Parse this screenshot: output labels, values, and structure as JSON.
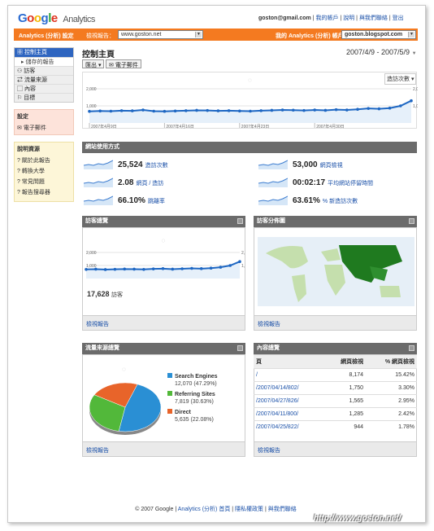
{
  "header": {
    "logo_google": "Google",
    "logo_analytics": "Analytics",
    "email": "goston@gmail.com",
    "links": [
      "我的帳戶",
      "說明",
      "與我們聯絡",
      "登出"
    ]
  },
  "toolbar": {
    "settings_label": "Analytics (分析) 設定",
    "view_report_label": "檢視報告：",
    "site_select": "www.goston.net",
    "account_label": "我的 Analytics (分析) 帳戶：",
    "account_select": "goston.blogspot.com"
  },
  "sidebar": {
    "nav": [
      {
        "label": "控制主頁",
        "active": true
      },
      {
        "label": "儲存的報告",
        "sub": true
      },
      {
        "label": "訪客"
      },
      {
        "label": "流量來源"
      },
      {
        "label": "內容"
      },
      {
        "label": "目標"
      }
    ],
    "settings_title": "設定",
    "settings_item": "電子郵件",
    "help_title": "說明資源",
    "help_items": [
      "關於此報告",
      "轉換大學",
      "常見問題",
      "報告搜尋器"
    ]
  },
  "page": {
    "title": "控制主頁",
    "date_range": "2007/4/9 - 2007/5/9",
    "export_btn": "匯出",
    "email_btn": "電子郵件",
    "visits_dropdown": "造訪次數"
  },
  "main_chart": {
    "y_labels": [
      "2,000",
      "1,000",
      "2,000",
      "1,000"
    ],
    "x_labels": [
      "2007年4月9日",
      "2007年4月16日",
      "2007年4月23日",
      "2007年4月30日"
    ],
    "values": [
      680,
      700,
      690,
      720,
      710,
      760,
      690,
      680,
      700,
      720,
      740,
      730,
      710,
      720,
      700,
      690,
      720,
      740,
      760,
      750,
      730,
      760,
      740,
      780,
      760,
      800,
      850,
      830,
      870,
      1000,
      1300
    ],
    "ylim": [
      0,
      2000
    ]
  },
  "site_usage": {
    "title": "網站使用方式",
    "metrics": [
      {
        "value": "25,524",
        "label": "造訪次數"
      },
      {
        "value": "53,000",
        "label": "網頁檢視"
      },
      {
        "value": "2.08",
        "label": "網頁 / 造訪"
      },
      {
        "value": "00:02:17",
        "label": "平均網站停留時間"
      },
      {
        "value": "66.10%",
        "label": "跳離率"
      },
      {
        "value": "63.61%",
        "label": "% 新造訪次數"
      }
    ]
  },
  "visitors_overview": {
    "title": "訪客總覽",
    "y_labels": [
      "2,000",
      "1,000",
      "2,000",
      "1,000"
    ],
    "values": [
      700,
      720,
      690,
      710,
      730,
      720,
      700,
      740,
      760,
      720,
      750,
      780,
      760,
      800,
      870,
      1000,
      1300
    ],
    "total": "17,628",
    "total_label": "訪客",
    "footer_link": "檢視報告"
  },
  "map_overlay": {
    "title": "訪客分佈圖",
    "footer_link": "檢視報告"
  },
  "traffic_sources": {
    "title": "流量來源總覽",
    "footer_link": "檢視報告",
    "colors": {
      "search": "#2a8fd4",
      "referring": "#52b83a",
      "direct": "#e8642a"
    },
    "items": [
      {
        "label": "Search Engines",
        "detail": "12,070 (47.29%)",
        "pct": 47.29
      },
      {
        "label": "Referring Sites",
        "detail": "7,819 (30.63%)",
        "pct": 30.63
      },
      {
        "label": "Direct",
        "detail": "5,635 (22.08%)",
        "pct": 22.08
      }
    ]
  },
  "content_overview": {
    "title": "內容總覽",
    "headers": [
      "頁",
      "網頁檢視",
      "% 網頁檢視"
    ],
    "rows": [
      [
        "/",
        "8,174",
        "15.42%"
      ],
      [
        "/2007/04/14/802/",
        "1,750",
        "3.30%"
      ],
      [
        "/2007/04/27/826/",
        "1,565",
        "2.95%"
      ],
      [
        "/2007/04/11/800/",
        "1,285",
        "2.42%"
      ],
      [
        "/2007/04/25/822/",
        "944",
        "1.78%"
      ]
    ],
    "footer_link": "檢視報告"
  },
  "footer": {
    "copyright": "© 2007 Google",
    "links": [
      "Analytics (分析) 首頁",
      "隱私權政策",
      "與我們聯絡"
    ],
    "watermark": "http://www.goston.net/"
  }
}
